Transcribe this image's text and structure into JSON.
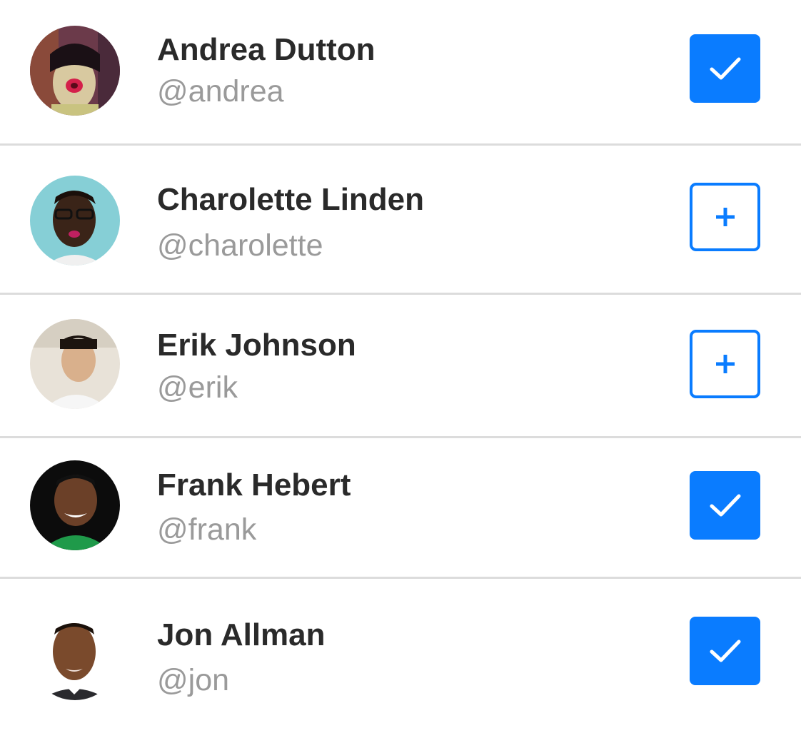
{
  "accent_color": "#0a7cff",
  "people": [
    {
      "name": "Andrea Dutton",
      "handle": "@andrea",
      "following": true,
      "toggle_icon": "checkmark-icon"
    },
    {
      "name": "Charolette Linden",
      "handle": "@charolette",
      "following": false,
      "toggle_icon": "plus-icon"
    },
    {
      "name": "Erik Johnson",
      "handle": "@erik",
      "following": false,
      "toggle_icon": "plus-icon"
    },
    {
      "name": "Frank Hebert",
      "handle": "@frank",
      "following": true,
      "toggle_icon": "checkmark-icon"
    },
    {
      "name": "Jon Allman",
      "handle": "@jon",
      "following": true,
      "toggle_icon": "checkmark-icon"
    }
  ]
}
